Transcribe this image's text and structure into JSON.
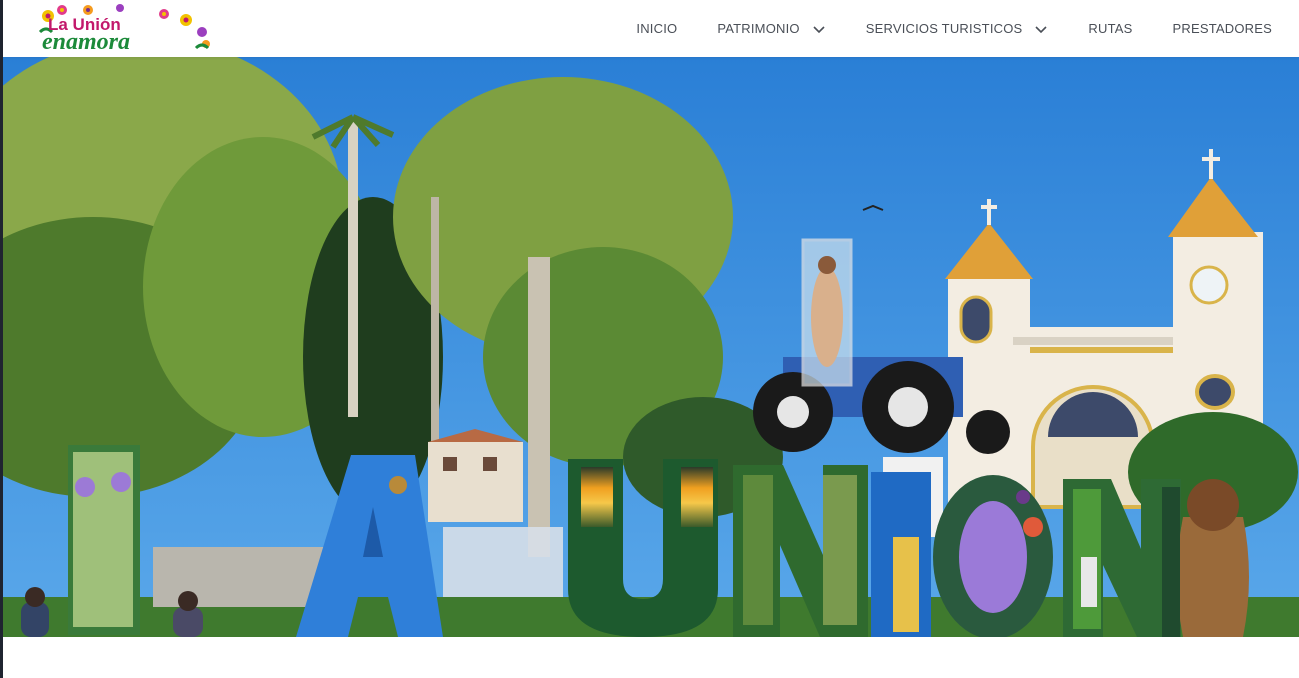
{
  "window": {
    "title": "La Unión enamora"
  },
  "brand": {
    "line1": "La Unión",
    "line2": "enamora",
    "colors": {
      "pink": "#c2186b",
      "green": "#1c8a3a",
      "yellow": "#f2c200"
    }
  },
  "nav": {
    "items": [
      {
        "label": "INICIO",
        "has_dropdown": false
      },
      {
        "label": "PATRIMONIO",
        "has_dropdown": true
      },
      {
        "label": "SERVICIOS TURISTICOS",
        "has_dropdown": true
      },
      {
        "label": "RUTAS",
        "has_dropdown": false
      },
      {
        "label": "PRESTADORES",
        "has_dropdown": false
      }
    ],
    "text_color": "#4a4f57"
  },
  "hero": {
    "scene": "town-square-church-letters",
    "letters": "LAUNION",
    "sky_color": "#2f87dc"
  }
}
